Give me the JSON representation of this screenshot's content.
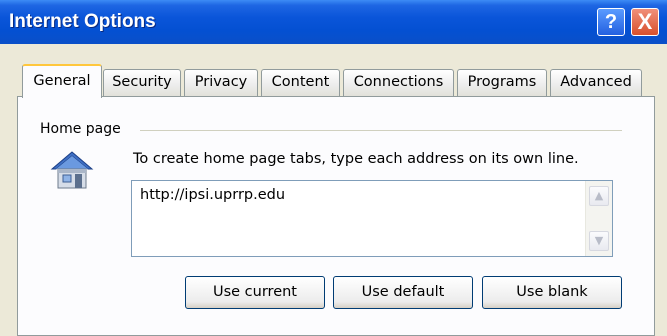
{
  "window": {
    "title": "Internet Options",
    "help_glyph": "?",
    "close_glyph": "X"
  },
  "tabs": [
    {
      "label": "General",
      "active": true
    },
    {
      "label": "Security"
    },
    {
      "label": "Privacy"
    },
    {
      "label": "Content"
    },
    {
      "label": "Connections"
    },
    {
      "label": "Programs"
    },
    {
      "label": "Advanced"
    }
  ],
  "home_page": {
    "group_label": "Home page",
    "instruction": "To create home page tabs, type each address on its own line.",
    "address_value": "http://ipsi.uprrp.edu",
    "scroll_up_glyph": "▲",
    "scroll_down_glyph": "▼",
    "buttons": {
      "use_current": "Use current",
      "use_default": "Use default",
      "use_blank": "Use blank"
    }
  },
  "colors": {
    "titlebar": "#0a55d9",
    "active_tab_accent": "#ffc73c",
    "dialog_bg": "#ece9d8",
    "close_button": "#d8502c"
  },
  "icons": {
    "house": "home-icon",
    "help": "help-icon",
    "close": "close-icon"
  }
}
